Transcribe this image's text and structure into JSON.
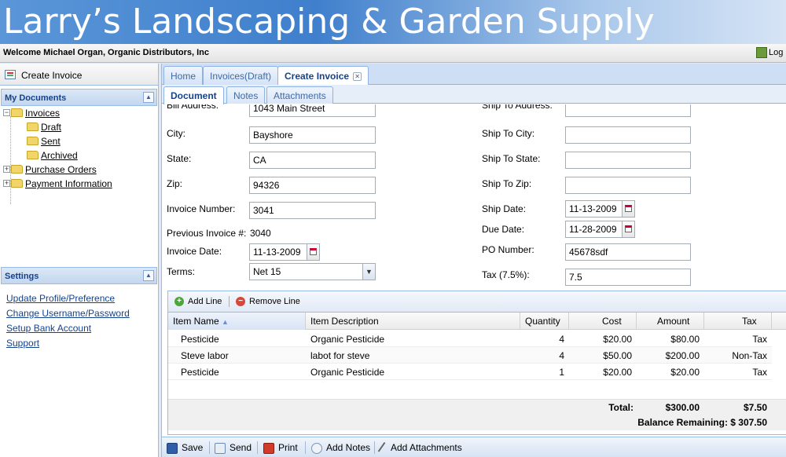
{
  "header": {
    "title": "Larry’s Landscaping & Garden Supply"
  },
  "welcome_bar": {
    "welcome": "Welcome Michael Organ, Organic Distributors, Inc",
    "logout": "Log"
  },
  "left": {
    "create_invoice": "Create Invoice",
    "my_documents": "My Documents",
    "tree": {
      "invoices": "Invoices",
      "draft": "Draft",
      "sent": "Sent",
      "archived": "Archived",
      "purchase_orders": "Purchase Orders",
      "payment_information": "Payment Information"
    },
    "settings": "Settings",
    "settings_links": [
      "Update Profile/Preference",
      "Change Username/Password",
      "Setup Bank Account",
      "Support"
    ]
  },
  "tabs": {
    "home": "Home",
    "invoices_draft": "Invoices(Draft)",
    "create_invoice": "Create Invoice"
  },
  "subtabs": {
    "document": "Document",
    "notes": "Notes",
    "attachments": "Attachments"
  },
  "form": {
    "bill_address_label": "Bill Address:",
    "bill_address": "1043 Main Street",
    "city_label": "City:",
    "city": "Bayshore",
    "state_label": "State:",
    "state": "CA",
    "zip_label": "Zip:",
    "zip": "94326",
    "invoice_number_label": "Invoice Number:",
    "invoice_number": "3041",
    "previous_invoice_label": "Previous Invoice #:",
    "previous_invoice": "3040",
    "invoice_date_label": "Invoice Date:",
    "invoice_date": "11-13-2009",
    "terms_label": "Terms:",
    "terms": "Net 15",
    "ship_address_label": "Ship To Address:",
    "ship_address": "",
    "ship_city_label": "Ship To City:",
    "ship_city": "",
    "ship_state_label": "Ship To State:",
    "ship_state": "",
    "ship_zip_label": "Ship To Zip:",
    "ship_zip": "",
    "ship_date_label": "Ship Date:",
    "ship_date": "11-13-2009",
    "due_date_label": "Due Date:",
    "due_date": "11-28-2009",
    "po_number_label": "PO Number:",
    "po_number": "45678sdf",
    "tax_label": "Tax (7.5%):",
    "tax": "7.5"
  },
  "grid": {
    "toolbar": {
      "add_line": "Add Line",
      "remove_line": "Remove Line"
    },
    "columns": [
      "Item Name",
      "Item Description",
      "Quantity",
      "Cost",
      "Amount",
      "Tax"
    ],
    "rows": [
      [
        "Pesticide",
        "Organic Pesticide",
        "4",
        "$20.00",
        "$80.00",
        "Tax"
      ],
      [
        "Steve labor",
        "labot for steve",
        "4",
        "$50.00",
        "$200.00",
        "Non-Tax"
      ],
      [
        "Pesticide",
        "Organic Pesticide",
        "1",
        "$20.00",
        "$20.00",
        "Tax"
      ]
    ],
    "total_label": "Total:",
    "total_amount": "$300.00",
    "total_tax": "$7.50",
    "balance": "Balance Remaining: $ 307.50"
  },
  "bottom_toolbar": {
    "save": "Save",
    "send": "Send",
    "print": "Print",
    "add_notes": "Add Notes",
    "add_attachments": "Add Attachments"
  },
  "colors": {
    "accent": "#15428b",
    "header_blue": "#3f7fcc",
    "panel_border": "#99bbe8"
  }
}
